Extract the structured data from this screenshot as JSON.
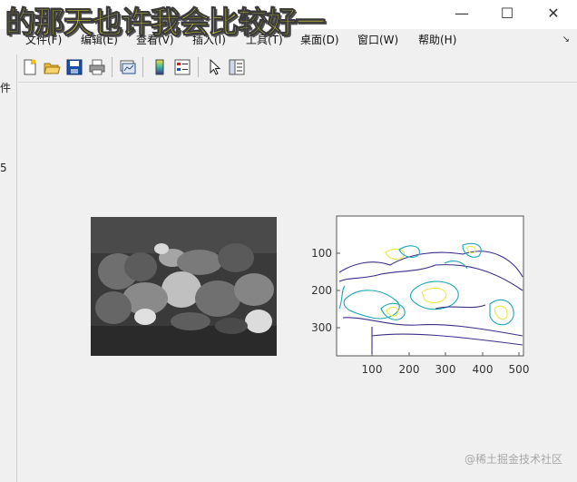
{
  "overlay_text": "的那天也许我会比较好一",
  "window_controls": {
    "minimize": "—",
    "maximize": "☐",
    "close": "✕"
  },
  "menu": [
    "文件(F)",
    "编辑(E)",
    "查看(V)",
    "插入(I)",
    "工具(T)",
    "桌面(D)",
    "窗口(W)",
    "帮助(H)"
  ],
  "menu_arrow": "↘",
  "toolbar_icons": [
    "new-figure-icon",
    "open-file-icon",
    "save-icon",
    "print-icon",
    "link-plot-icon",
    "insert-colorbar-icon",
    "insert-legend-icon",
    "edit-plot-arrow-icon",
    "property-editor-icon"
  ],
  "left_strip": {
    "stub1": "件",
    "stub2": "5"
  },
  "axes2": {
    "yticks": [
      "100",
      "200",
      "300"
    ],
    "xticks": [
      "100",
      "200",
      "300",
      "400",
      "500"
    ]
  },
  "watermark": "@稀土掘金技术社区",
  "colors": {
    "contour_dark": "#3b2f86",
    "contour_mid": "#1ea5b8",
    "contour_light": "#e9e84a"
  }
}
